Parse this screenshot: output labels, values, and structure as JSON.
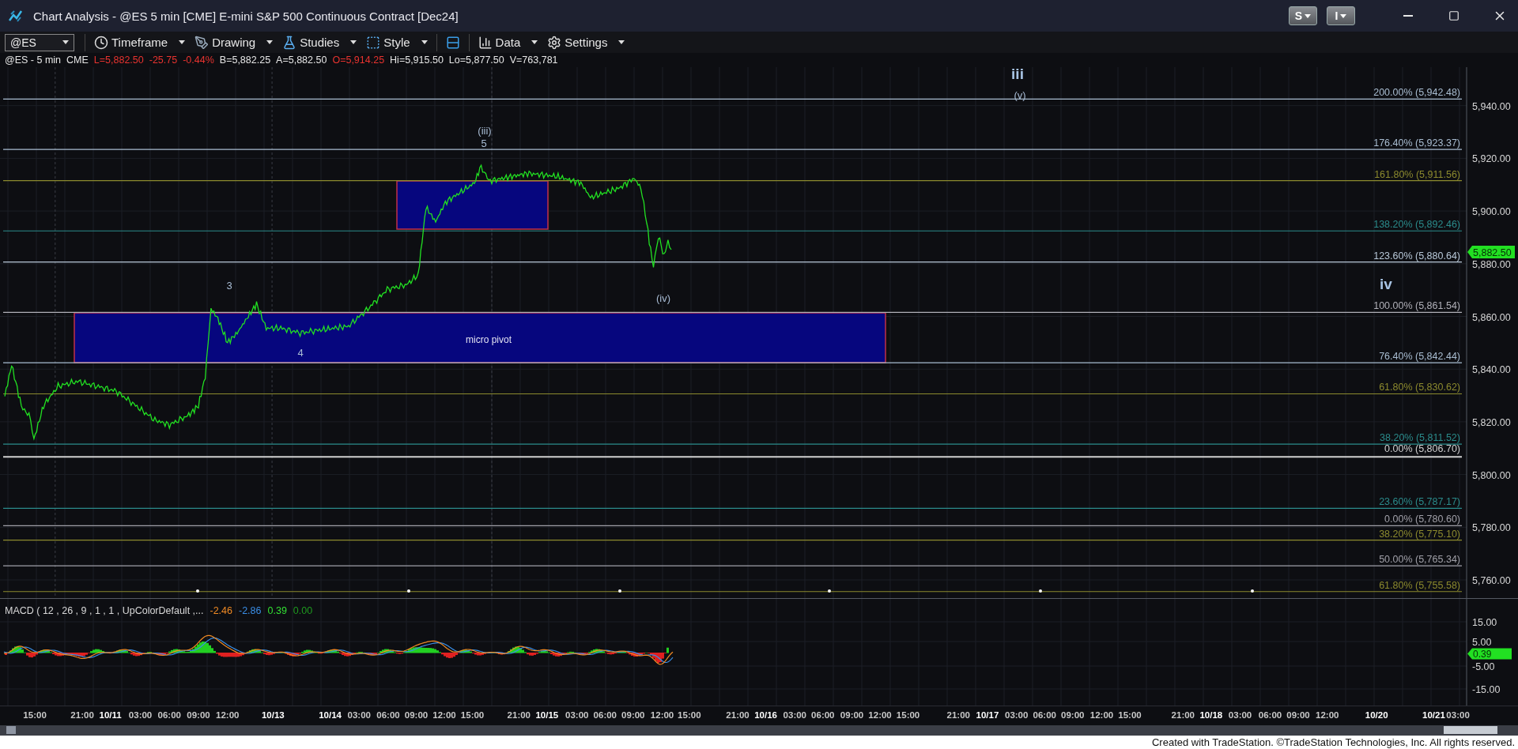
{
  "window": {
    "title": "Chart Analysis - @ES 5 min [CME] E-mini S&P 500 Continuous Contract [Dec24]",
    "buttons": [
      "S",
      "I"
    ]
  },
  "toolbar": {
    "symbol": "@ES",
    "items": [
      {
        "kind": "menu",
        "label": "Timeframe"
      },
      {
        "kind": "menu",
        "label": "Drawing"
      },
      {
        "kind": "menu",
        "label": "Studies"
      },
      {
        "kind": "menu",
        "label": "Style"
      },
      {
        "kind": "icon"
      },
      {
        "kind": "menu",
        "label": "Data"
      },
      {
        "kind": "menu",
        "label": "Settings"
      }
    ]
  },
  "info_line": [
    {
      "text": "@ES - 5 min",
      "color": "#e6e6e6"
    },
    {
      "text": "CME",
      "color": "#e6e6e6"
    },
    {
      "text": "L=5,882.50",
      "color": "#e8332f"
    },
    {
      "text": "-25.75",
      "color": "#e8332f"
    },
    {
      "text": "-0.44%",
      "color": "#e8332f"
    },
    {
      "text": "B=5,882.25",
      "color": "#e6e6e6"
    },
    {
      "text": "A=5,882.50",
      "color": "#e6e6e6"
    },
    {
      "text": "O=5,914.25",
      "color": "#e8332f"
    },
    {
      "text": "Hi=5,915.50",
      "color": "#e6e6e6"
    },
    {
      "text": "Lo=5,877.50",
      "color": "#e6e6e6"
    },
    {
      "text": "V=763,781",
      "color": "#e6e6e6"
    }
  ],
  "price_chart": {
    "wave_labels": [
      {
        "text": "iii",
        "kind": "major"
      },
      {
        "text": "(v)",
        "kind": "minor"
      },
      {
        "text": "(iii)",
        "kind": "minor"
      },
      {
        "text": "5",
        "kind": "minor"
      },
      {
        "text": "iv",
        "kind": "major"
      },
      {
        "text": "3",
        "kind": "minor"
      },
      {
        "text": "(iv)",
        "kind": "minor"
      },
      {
        "text": "4",
        "kind": "minor"
      }
    ],
    "pivot_zone": {
      "label": "micro pivot"
    },
    "fib_levels": [
      {
        "label": "200.00% (5,942.48)",
        "color": "#a9bdd1"
      },
      {
        "label": "176.40% (5,923.37)",
        "color": "#a9bdd1"
      },
      {
        "label": "161.80% (5,911.56)",
        "color": "#8c8a2e"
      },
      {
        "label": "138.20% (5,892.46)",
        "color": "#2b8c8c"
      },
      {
        "label": "123.60% (5,880.64)",
        "color": "#b8c8d8"
      },
      {
        "label": "100.00% (5,861.54)",
        "color": "#b0b0b8"
      },
      {
        "label": "76.40% (5,842.44)",
        "color": "#a9bdd1"
      },
      {
        "label": "61.80% (5,830.62)",
        "color": "#8c8a2e"
      },
      {
        "label": "38.20% (5,811.52)",
        "color": "#2b8c8c"
      },
      {
        "label": "0.00% (5,806.70)",
        "color": "#d0d0d0"
      },
      {
        "label": "23.60% (5,787.17)",
        "color": "#2b8c8c"
      },
      {
        "label": "0.00% (5,780.60)",
        "color": "#a0a0a8"
      },
      {
        "label": "38.20% (5,775.10)",
        "color": "#8c8a2e"
      },
      {
        "label": "50.00% (5,765.34)",
        "color": "#a0a0a8"
      },
      {
        "label": "61.80% (5,755.58)",
        "color": "#8c8a2e"
      }
    ],
    "y_axis": [
      "5,940.00",
      "5,920.00",
      "5,900.00",
      "5,880.00",
      "5,860.00",
      "5,840.00",
      "5,820.00",
      "5,800.00",
      "5,780.00",
      "5,760.00"
    ],
    "last_price": "5,882.50"
  },
  "macd": {
    "title": "MACD ( 12 , 26 , 9 , 1 , 1 , UpColorDefault ,...",
    "values": [
      {
        "text": "-2.46",
        "color": "#f08a24"
      },
      {
        "text": "-2.86",
        "color": "#3a8ee6"
      },
      {
        "text": "0.39",
        "color": "#33e033"
      },
      {
        "text": "0.00",
        "color": "#1f9a1f"
      }
    ],
    "y_axis": [
      "15.00",
      "5.00",
      "-5.00",
      "-15.00"
    ],
    "last_value": "0.39"
  },
  "time_axis": [
    {
      "text": "15:00",
      "kind": "time"
    },
    {
      "text": "21:00",
      "kind": "time"
    },
    {
      "text": "10/11",
      "kind": "date"
    },
    {
      "text": "03:00",
      "kind": "time"
    },
    {
      "text": "06:00",
      "kind": "time"
    },
    {
      "text": "09:00",
      "kind": "time"
    },
    {
      "text": "12:00",
      "kind": "time"
    },
    {
      "text": "10/13",
      "kind": "date"
    },
    {
      "text": "10/14",
      "kind": "date"
    },
    {
      "text": "03:00",
      "kind": "time"
    },
    {
      "text": "06:00",
      "kind": "time"
    },
    {
      "text": "09:00",
      "kind": "time"
    },
    {
      "text": "12:00",
      "kind": "time"
    },
    {
      "text": "15:00",
      "kind": "time"
    },
    {
      "text": "21:00",
      "kind": "time"
    },
    {
      "text": "10/15",
      "kind": "date"
    },
    {
      "text": "03:00",
      "kind": "time"
    },
    {
      "text": "06:00",
      "kind": "time"
    },
    {
      "text": "09:00",
      "kind": "time"
    },
    {
      "text": "12:00",
      "kind": "time"
    },
    {
      "text": "15:00",
      "kind": "time"
    },
    {
      "text": "21:00",
      "kind": "time"
    },
    {
      "text": "10/16",
      "kind": "date"
    },
    {
      "text": "03:00",
      "kind": "time"
    },
    {
      "text": "06:00",
      "kind": "time"
    },
    {
      "text": "09:00",
      "kind": "time"
    },
    {
      "text": "12:00",
      "kind": "time"
    },
    {
      "text": "15:00",
      "kind": "time"
    },
    {
      "text": "21:00",
      "kind": "time"
    },
    {
      "text": "10/17",
      "kind": "date"
    },
    {
      "text": "03:00",
      "kind": "time"
    },
    {
      "text": "06:00",
      "kind": "time"
    },
    {
      "text": "09:00",
      "kind": "time"
    },
    {
      "text": "12:00",
      "kind": "time"
    },
    {
      "text": "15:00",
      "kind": "time"
    },
    {
      "text": "21:00",
      "kind": "time"
    },
    {
      "text": "10/18",
      "kind": "date"
    },
    {
      "text": "03:00",
      "kind": "time"
    },
    {
      "text": "06:00",
      "kind": "time"
    },
    {
      "text": "09:00",
      "kind": "time"
    },
    {
      "text": "12:00",
      "kind": "time"
    },
    {
      "text": "10/20",
      "kind": "date"
    },
    {
      "text": "10/21",
      "kind": "date"
    },
    {
      "text": "03:00",
      "kind": "time"
    }
  ],
  "footer": "Created with TradeStation. ©TradeStation Technologies, Inc. All rights reserved."
}
